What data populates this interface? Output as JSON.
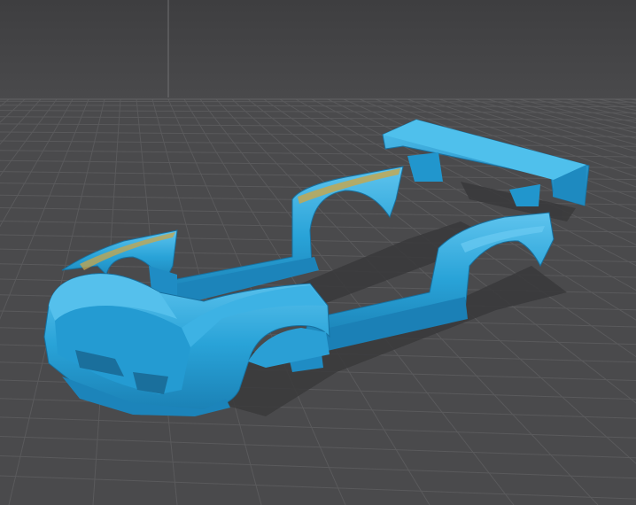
{
  "viewport": {
    "background_color": "#4a4a4c",
    "grid_line_color": "#5a5a5c",
    "grid_major_color": "#626264",
    "model_color": "#29a3d8",
    "model_shadow_color": "#3b3b3d",
    "model_highlight_color": "#7fd4f5",
    "model_dark_color": "#1777a8",
    "edge_accent_color": "#c9a64a"
  },
  "scene": {
    "grid_visible": true,
    "objects": [
      {
        "part": "front-bumper-and-left-front-fender"
      },
      {
        "part": "right-front-fender"
      },
      {
        "part": "left-rear-fender-and-side-skirt"
      },
      {
        "part": "right-rear-fender-and-side-skirt"
      },
      {
        "part": "rear-spoiler-wing"
      },
      {
        "part": "spoiler-mount-left"
      },
      {
        "part": "spoiler-mount-right"
      }
    ]
  }
}
